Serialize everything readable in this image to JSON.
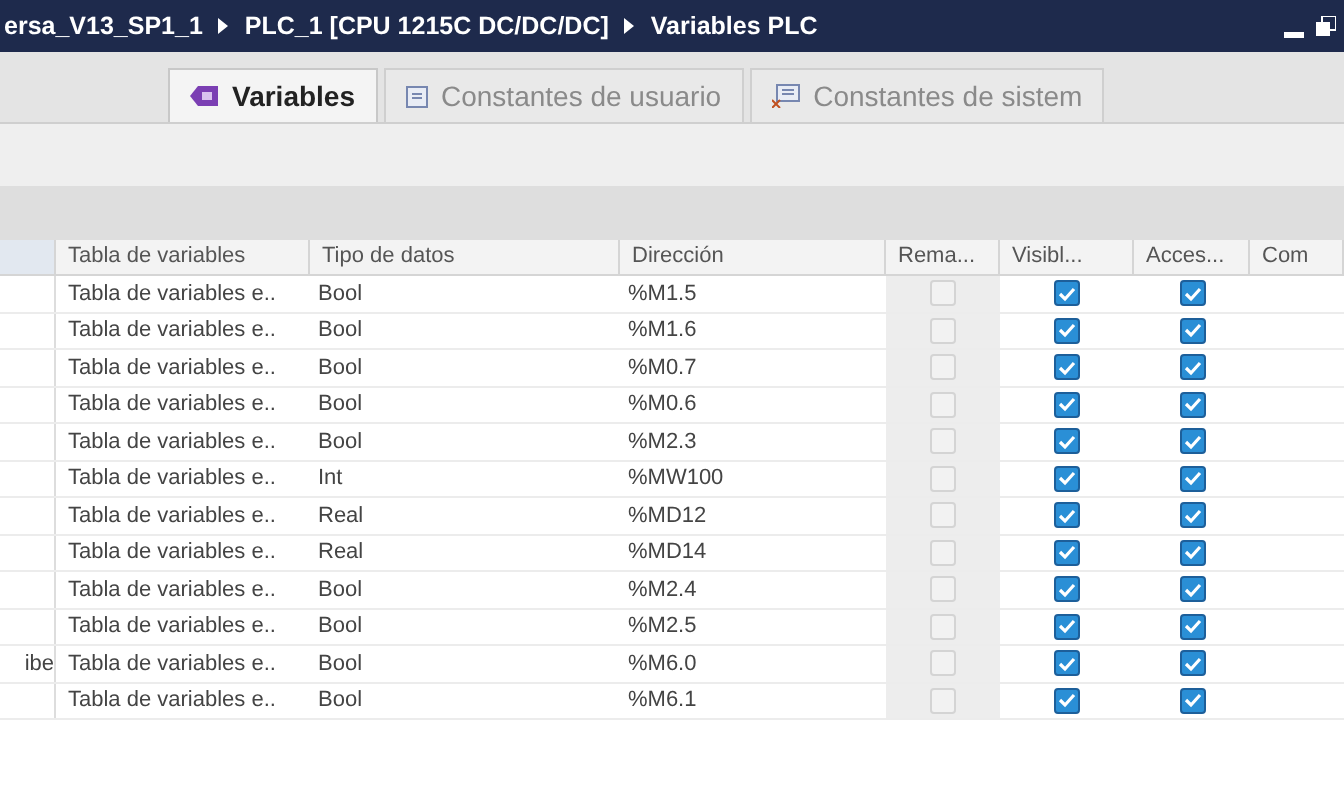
{
  "title_bar": {
    "breadcrumbs": [
      "ersa_V13_SP1_1",
      "PLC_1 [CPU 1215C DC/DC/DC]",
      "Variables PLC"
    ]
  },
  "tabs": [
    {
      "label": "Variables",
      "selected": true,
      "kind": "variables"
    },
    {
      "label": "Constantes de usuario",
      "selected": false,
      "kind": "user"
    },
    {
      "label": "Constantes de sistem",
      "selected": false,
      "kind": "system"
    }
  ],
  "table": {
    "columns": [
      "",
      "Tabla de variables",
      "Tipo de datos",
      "Dirección",
      "Rema...",
      "Visibl...",
      "Acces...",
      "Com"
    ],
    "rows": [
      {
        "column_1": "",
        "table": "Tabla de variables e..",
        "type": "Bool",
        "address": "%M1.5",
        "retain": false,
        "visible": true,
        "accessible": true
      },
      {
        "column_1": "",
        "table": "Tabla de variables e..",
        "type": "Bool",
        "address": "%M1.6",
        "retain": false,
        "visible": true,
        "accessible": true
      },
      {
        "column_1": "",
        "table": "Tabla de variables e..",
        "type": "Bool",
        "address": "%M0.7",
        "retain": false,
        "visible": true,
        "accessible": true
      },
      {
        "column_1": "",
        "table": "Tabla de variables e..",
        "type": "Bool",
        "address": "%M0.6",
        "retain": false,
        "visible": true,
        "accessible": true
      },
      {
        "column_1": "",
        "table": "Tabla de variables e..",
        "type": "Bool",
        "address": "%M2.3",
        "retain": false,
        "visible": true,
        "accessible": true
      },
      {
        "column_1": "",
        "table": "Tabla de variables e..",
        "type": "Int",
        "address": "%MW100",
        "retain": false,
        "visible": true,
        "accessible": true
      },
      {
        "column_1": "",
        "table": "Tabla de variables e..",
        "type": "Real",
        "address": "%MD12",
        "retain": false,
        "visible": true,
        "accessible": true
      },
      {
        "column_1": "",
        "table": "Tabla de variables e..",
        "type": "Real",
        "address": "%MD14",
        "retain": false,
        "visible": true,
        "accessible": true
      },
      {
        "column_1": "",
        "table": "Tabla de variables e..",
        "type": "Bool",
        "address": "%M2.4",
        "retain": false,
        "visible": true,
        "accessible": true
      },
      {
        "column_1": "",
        "table": "Tabla de variables e..",
        "type": "Bool",
        "address": "%M2.5",
        "retain": false,
        "visible": true,
        "accessible": true
      },
      {
        "column_1": "ibe",
        "table": "Tabla de variables e..",
        "type": "Bool",
        "address": "%M6.0",
        "retain": false,
        "visible": true,
        "accessible": true
      },
      {
        "column_1": "",
        "table": "Tabla de variables e..",
        "type": "Bool",
        "address": "%M6.1",
        "retain": false,
        "visible": true,
        "accessible": true
      }
    ]
  }
}
